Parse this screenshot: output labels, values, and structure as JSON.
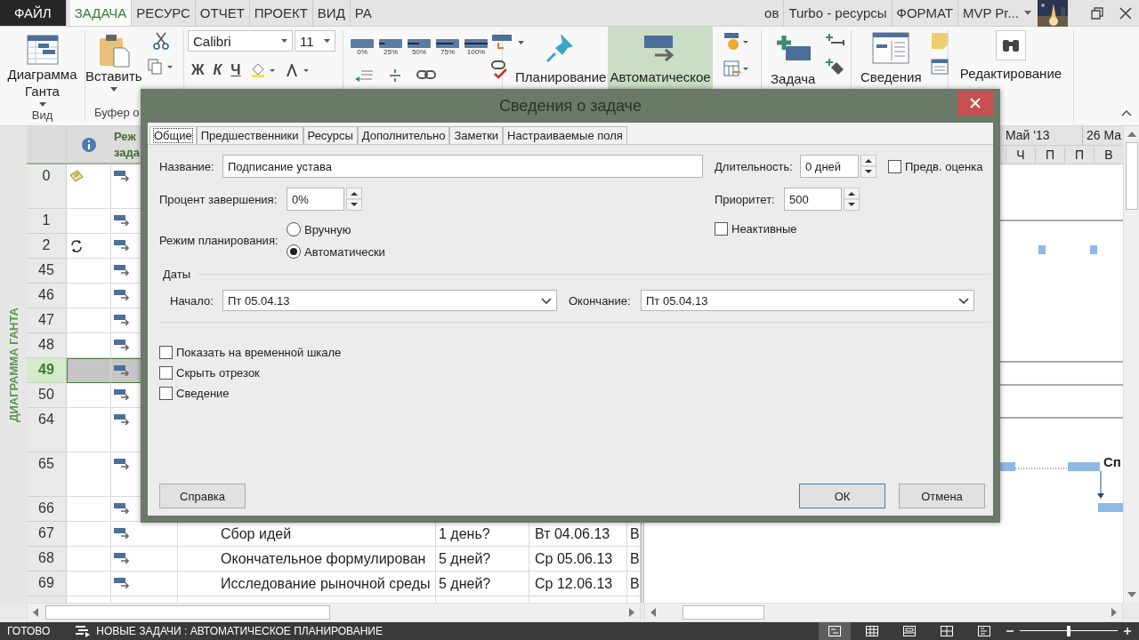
{
  "tabs_left": [
    {
      "label": "ФАЙЛ",
      "kind": "file",
      "selected": false
    },
    {
      "label": "ЗАДАЧА",
      "kind": "tab",
      "selected": true
    },
    {
      "label": "РЕСУРС",
      "kind": "tab",
      "selected": false
    },
    {
      "label": "ОТЧЕТ",
      "kind": "tab",
      "selected": false
    },
    {
      "label": "ПРОЕКТ",
      "kind": "tab",
      "selected": false
    },
    {
      "label": "ВИД",
      "kind": "tab",
      "selected": false
    },
    {
      "label": "РА",
      "kind": "tab",
      "selected": false
    }
  ],
  "tabs_right": [
    {
      "label": "ов",
      "kind": "tab",
      "selected": false
    },
    {
      "label": "Turbo - ресурсы",
      "kind": "tab",
      "selected": false
    },
    {
      "label": "ФОРМАТ",
      "kind": "tab",
      "selected": false
    },
    {
      "label": "MVP Pr...",
      "kind": "dropdown",
      "selected": false
    }
  ],
  "ribbon": {
    "view": {
      "button": "Диаграмма Ганта",
      "group": "Вид"
    },
    "clipboard": {
      "button": "Вставить",
      "group": "Буфер о"
    },
    "font": {
      "family": "Calibri",
      "size": "11",
      "styles": [
        {
          "label": "Ж",
          "kind": "bold"
        },
        {
          "label": "К",
          "kind": "italic"
        },
        {
          "label": "Ч",
          "kind": "underline"
        }
      ]
    },
    "progress": [
      "0%",
      "25%",
      "50%",
      "75%",
      "100%"
    ],
    "modes": [
      {
        "label": "Планирование",
        "selected": false
      },
      {
        "label": "Автоматическое",
        "selected": true
      }
    ],
    "insert": "Задача",
    "properties": "Сведения",
    "editing": "Редактирование"
  },
  "sheet": {
    "view_label": "ДИАГРАММА ГАНТА",
    "mode_header": [
      "Реж",
      "зада"
    ],
    "rows": [
      {
        "id": "0",
        "tall": true,
        "selected": false,
        "kind": "note"
      },
      {
        "id": "1",
        "tall": false,
        "selected": false,
        "kind": "plain"
      },
      {
        "id": "2",
        "tall": false,
        "selected": false,
        "kind": "recurring"
      },
      {
        "id": "45",
        "tall": false,
        "selected": false,
        "kind": "plain"
      },
      {
        "id": "46",
        "tall": false,
        "selected": false,
        "kind": "plain"
      },
      {
        "id": "47",
        "tall": false,
        "selected": false,
        "kind": "plain"
      },
      {
        "id": "48",
        "tall": false,
        "selected": false,
        "kind": "plain"
      },
      {
        "id": "49",
        "tall": false,
        "selected": true,
        "kind": "plain"
      },
      {
        "id": "50",
        "tall": false,
        "selected": false,
        "kind": "plain"
      },
      {
        "id": "64",
        "tall": true,
        "selected": false,
        "kind": "plain"
      },
      {
        "id": "65",
        "tall": true,
        "selected": false,
        "kind": "plain"
      },
      {
        "id": "66",
        "tall": false,
        "selected": false,
        "kind": "plain"
      },
      {
        "id": "67",
        "tall": false,
        "selected": false,
        "kind": "plain",
        "name": "Сбор идей",
        "duration": "1 день?",
        "start": "Вт 04.06.13",
        "column_7": "В"
      },
      {
        "id": "68",
        "tall": false,
        "selected": false,
        "kind": "plain",
        "name": "Окончательное формулирован",
        "duration": "5 дней?",
        "start": "Ср 05.06.13",
        "column_7": "В"
      },
      {
        "id": "69",
        "tall": false,
        "selected": false,
        "kind": "plain",
        "name": "Исследование рыночной среды",
        "duration": "5 дней?",
        "start": "Ср 12.06.13",
        "column_7": "В"
      }
    ]
  },
  "gantt": {
    "timescale_top": [
      "Май '13",
      "26 Ма"
    ],
    "timescale_days": [
      "Ч",
      "П",
      "П",
      "В"
    ],
    "bar_label": "Сп"
  },
  "dialog": {
    "title": "Сведения о задаче",
    "tabs": [
      {
        "label": "Общие",
        "selected": true
      },
      {
        "label": "Предшественники",
        "selected": false
      },
      {
        "label": "Ресурсы",
        "selected": false
      },
      {
        "label": "Дополнительно",
        "selected": false
      },
      {
        "label": "Заметки",
        "selected": false
      },
      {
        "label": "Настраиваемые поля",
        "selected": false
      }
    ],
    "name": {
      "label": "Название:",
      "value": "Подписание устава"
    },
    "duration": {
      "label": "Длительность:",
      "value": "0 дней"
    },
    "estimated": {
      "label": "Предв. оценка",
      "checked": false
    },
    "percent_complete": {
      "label": "Процент завершения:",
      "value": "0%"
    },
    "priority": {
      "label": "Приоритет:",
      "value": "500"
    },
    "schedule_mode": {
      "label": "Режим планирования:",
      "options": [
        {
          "label": "Вручную",
          "selected": false
        },
        {
          "label": "Автоматически",
          "selected": true
        }
      ]
    },
    "inactive": {
      "label": "Неактивные",
      "checked": false
    },
    "dates": {
      "title": "Даты",
      "start": {
        "label": "Начало:",
        "value": "Пт 05.04.13"
      },
      "finish": {
        "label": "Окончание:",
        "value": "Пт 05.04.13"
      }
    },
    "options": [
      {
        "label": "Показать на временной шкале",
        "checked": false
      },
      {
        "label": "Скрыть отрезок",
        "checked": false
      },
      {
        "label": "Сведение",
        "checked": false
      }
    ],
    "buttons": [
      {
        "label": "Справка",
        "kind": "help"
      },
      {
        "label": "ОК",
        "kind": "default"
      },
      {
        "label": "Отмена",
        "kind": "cancel"
      }
    ]
  },
  "status_bar": {
    "ready": "ГОТОВО",
    "new_tasks": "НОВЫЕ ЗАДАЧИ : АВТОМАТИЧЕСКОЕ ПЛАНИРОВАНИЕ",
    "views": [
      {
        "selected": true
      },
      {
        "selected": false
      },
      {
        "selected": false
      },
      {
        "selected": false
      },
      {
        "selected": false
      }
    ],
    "zoom": {
      "level": 0.5
    }
  }
}
